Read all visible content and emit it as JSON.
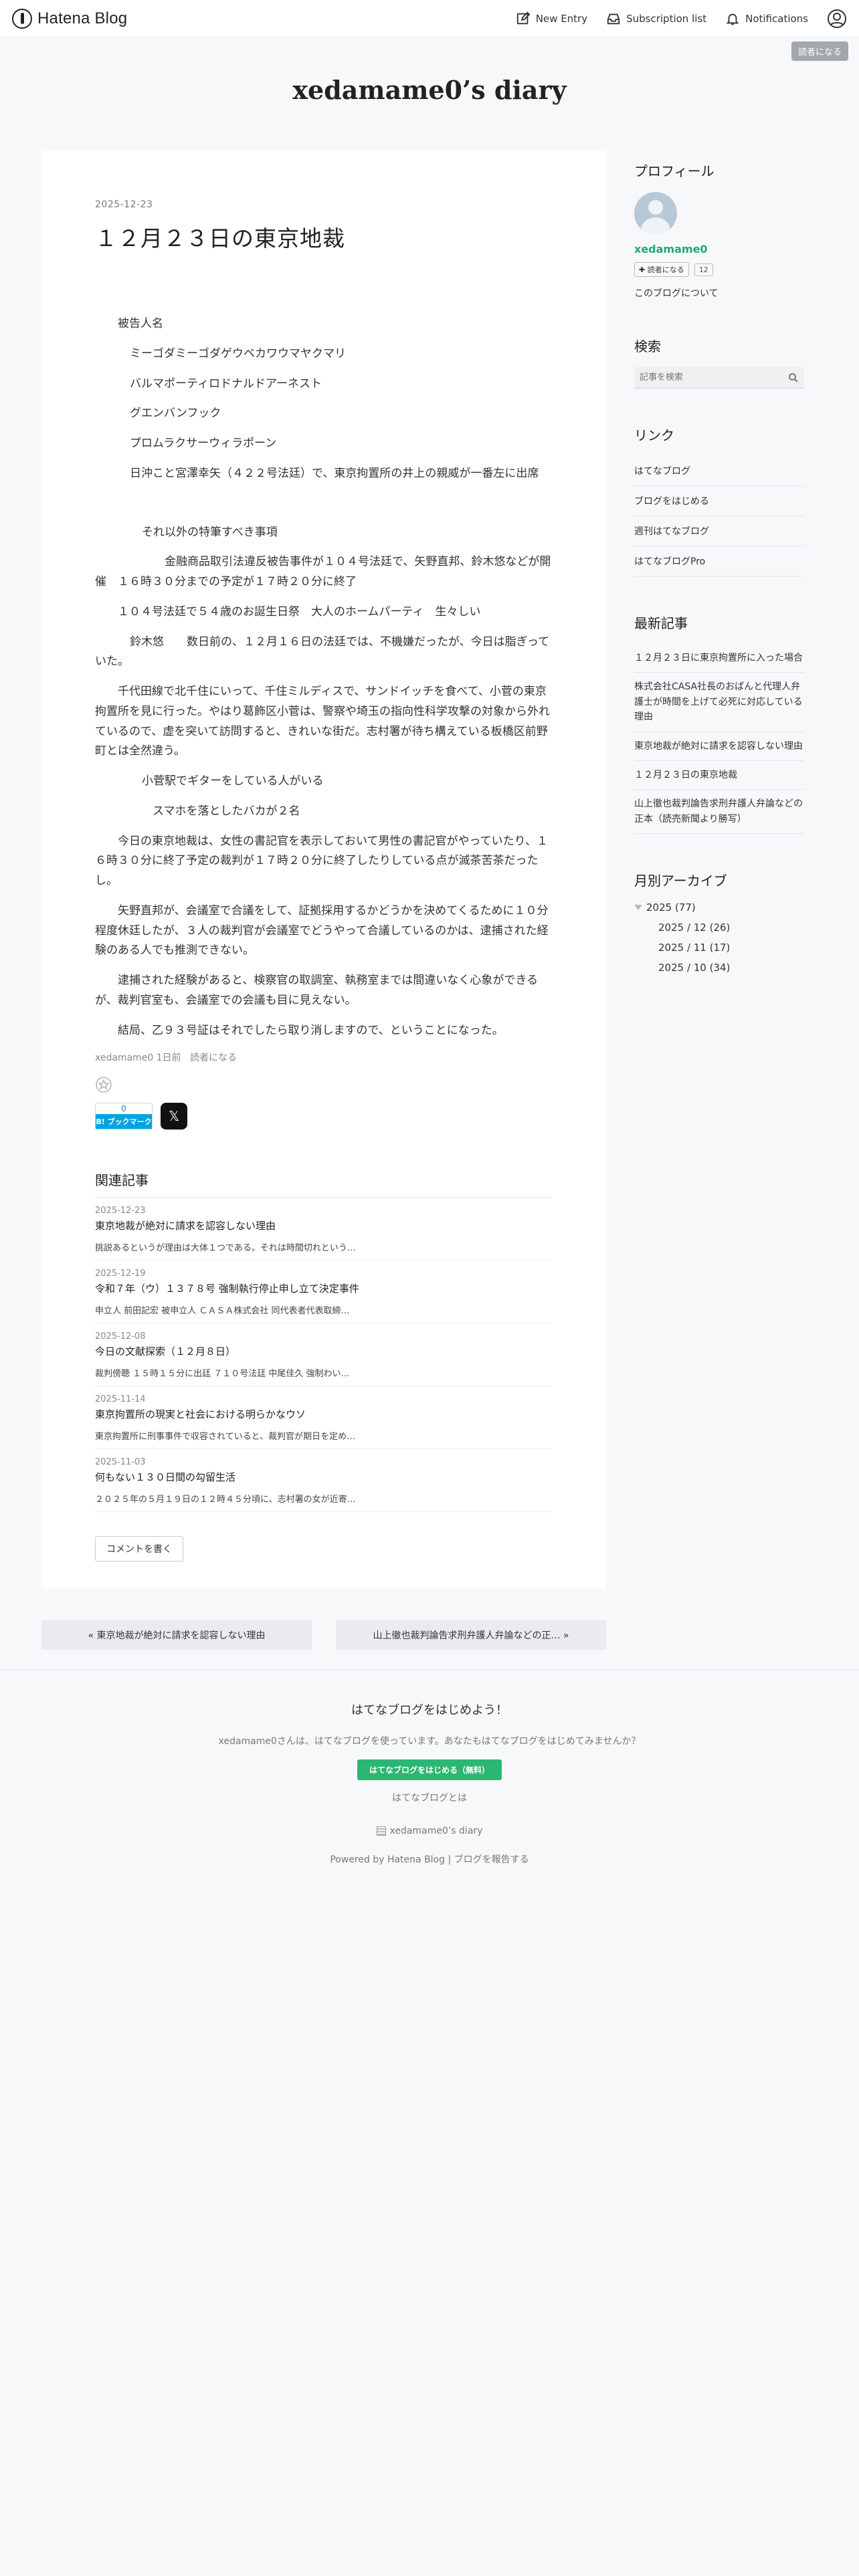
{
  "header": {
    "logo_text": "Hatena Blog",
    "new_entry": "New Entry",
    "subscription": "Subscription list",
    "notifications": "Notifications"
  },
  "reader_button": "読者になる",
  "blog_title": "xedamame0’s diary",
  "entry": {
    "date": "2025-12-23",
    "title": "１２月２３日の東京地裁",
    "paragraphs": [
      "被告人名",
      "ミーゴダミーゴダゲウベカワウマヤクマリ",
      "バルマポーティロドナルドアーネスト",
      "グエンバンフック",
      "プロムラクサーウィラポーン",
      "日沖こと宮澤幸矢（４２２号法廷）で、東京拘置所の井上の親威が一番左に出席",
      "それ以外の特筆すべき事項",
      "金融商品取引法違反被告事件が１０４号法廷で、矢野直邦、鈴木悠などが開催　１６時３０分までの予定が１７時２０分に終了",
      "１０４号法廷で５４歳のお誕生日祭　大人のホームパーティ　生々しい",
      "鈴木悠　　数日前の、１２月１６日の法廷では、不機嫌だったが、今日は脂ぎっていた。",
      "千代田線で北千住にいって、千住ミルディスで、サンドイッチを食べて、小菅の東京拘置所を見に行った。やはり葛飾区小菅は、警察や埼玉の指向性科学攻撃の対象から外れているので、虚を突いて訪問すると、きれいな街だ。志村署が待ち構えている板橋区前野町とは全然違う。",
      "小菅駅でギターをしている人がいる",
      "スマホを落としたバカが２名",
      "今日の東京地裁は、女性の書記官を表示しておいて男性の書記官がやっていたり、１６時３０分に終了予定の裁判が１７時２０分に終了したりしている点が滅茶苦茶だったし。",
      "矢野直邦が、会議室で合議をして、証拠採用するかどうかを決めてくるために１０分程度休廷したが、３人の裁判官が会議室でどうやって合議しているのかは、逮捕された経験のある人でも推測できない。",
      "逮捕された経験があると、検察官の取調室、執務室までは間違いなく心象ができるが、裁判官室も、会議室での会議も目に見えない。",
      "結局、乙９３号証はそれでしたら取り消しますので、ということになった。"
    ],
    "meta_author": "xedamame0",
    "meta_time": "1日前",
    "meta_reader": "読者になる",
    "hb_count": "0",
    "hb_label": "B! ブックマーク",
    "x_label": "𝕏"
  },
  "related": {
    "heading": "関連記事",
    "items": [
      {
        "date": "2025-12-23",
        "title": "東京地裁が絶対に請求を認容しない理由",
        "excerpt": "挑説あるというが理由は大体１つである。それは時間切れという…"
      },
      {
        "date": "2025-12-19",
        "title": "令和７年（ウ）１３７８号 強制執行停止申し立て決定事件",
        "excerpt": "申立人 前田記宏 被申立人 ＣＡＳＡ株式会社 同代表者代表取締…"
      },
      {
        "date": "2025-12-08",
        "title": "今日の文献探索（１２月８日）",
        "excerpt": "裁判傍聴 １５時１５分に出廷 ７１０号法廷 中尾佳久 強制わい…"
      },
      {
        "date": "2025-11-14",
        "title": "東京拘置所の現実と社会における明らかなウソ",
        "excerpt": "東京拘置所に刑事事件で収容されていると、裁判官が期日を定め…"
      },
      {
        "date": "2025-11-03",
        "title": "何もない１３０日間の勾留生活",
        "excerpt": "２０２５年の５月１９日の１２時４５分頃に、志村署の女が近寄…"
      }
    ]
  },
  "comment_button": "コメントを書く",
  "pager": {
    "prev": "« 東京地裁が絶対に請求を認容しない理由",
    "next": "山上徹也裁判論告求刑弁護人弁論などの正… »"
  },
  "sidebar": {
    "profile": {
      "heading": "プロフィール",
      "name": "xedamame0",
      "follow": "✚ 読者になる",
      "count": "12",
      "about": "このブログについて"
    },
    "search": {
      "heading": "検索",
      "placeholder": "記事を検索"
    },
    "links": {
      "heading": "リンク",
      "items": [
        "はてなブログ",
        "ブログをはじめる",
        "週刊はてなブログ",
        "はてなブログPro"
      ]
    },
    "recent": {
      "heading": "最新記事",
      "items": [
        "１２月２３日に東京拘置所に入った場合",
        "株式会社CASA社長のおばんと代理人弁護士が時間を上げて必死に対応している理由",
        "東京地裁が絶対に請求を認容しない理由",
        "１２月２３日の東京地裁",
        "山上徹也裁判論告求刑弁護人弁論などの正本（読売新聞より勝写）"
      ]
    },
    "archive": {
      "heading": "月別アーカイブ",
      "year": "2025 (77)",
      "months": [
        "2025 / 12 (26)",
        "2025 / 11 (17)",
        "2025 / 10 (34)"
      ]
    }
  },
  "footer": {
    "heading": "はてなブログをはじめよう！",
    "desc": "xedamame0さんは、はてなブログを使っています。あなたもはてなブログをはじめてみませんか？",
    "cta": "はてなブログをはじめる（無料）",
    "about": "はてなブログとは",
    "blog_name": "xedamame0’s diary",
    "powered": "Powered by Hatena Blog | ブログを報告する"
  }
}
